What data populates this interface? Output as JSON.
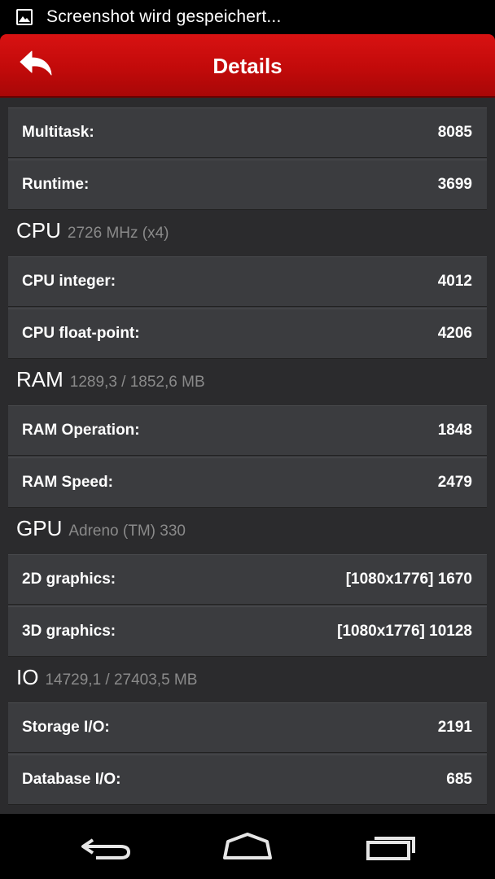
{
  "status_bar": {
    "notification_text": "Screenshot wird gespeichert..."
  },
  "header": {
    "title": "Details"
  },
  "summary": {
    "rows": [
      {
        "label": "Multitask:",
        "value": "8085"
      },
      {
        "label": "Runtime:",
        "value": "3699"
      }
    ]
  },
  "sections": [
    {
      "title": "CPU",
      "subtitle": "2726 MHz (x4)",
      "rows": [
        {
          "label": "CPU integer:",
          "value": "4012"
        },
        {
          "label": "CPU float-point:",
          "value": "4206"
        }
      ]
    },
    {
      "title": "RAM",
      "subtitle": "1289,3 / 1852,6 MB",
      "rows": [
        {
          "label": "RAM Operation:",
          "value": "1848"
        },
        {
          "label": "RAM Speed:",
          "value": "2479"
        }
      ]
    },
    {
      "title": "GPU",
      "subtitle": "Adreno (TM) 330",
      "rows": [
        {
          "label": "2D graphics:",
          "value": "[1080x1776] 1670"
        },
        {
          "label": "3D graphics:",
          "value": "[1080x1776] 10128"
        }
      ]
    },
    {
      "title": "IO",
      "subtitle": "14729,1 / 27403,5 MB",
      "rows": [
        {
          "label": "Storage I/O:",
          "value": "2191"
        },
        {
          "label": "Database I/O:",
          "value": "685"
        }
      ]
    }
  ],
  "icons": {
    "status": "image-icon",
    "back": "back-arrow-icon",
    "nav_back": "nav-back-icon",
    "nav_home": "nav-home-icon",
    "nav_recents": "nav-recents-icon"
  },
  "colors": {
    "header_red": "#c20a0a",
    "background": "#2b2b2d",
    "row": "#3b3c3f",
    "subtitle": "#8a8a8a"
  }
}
